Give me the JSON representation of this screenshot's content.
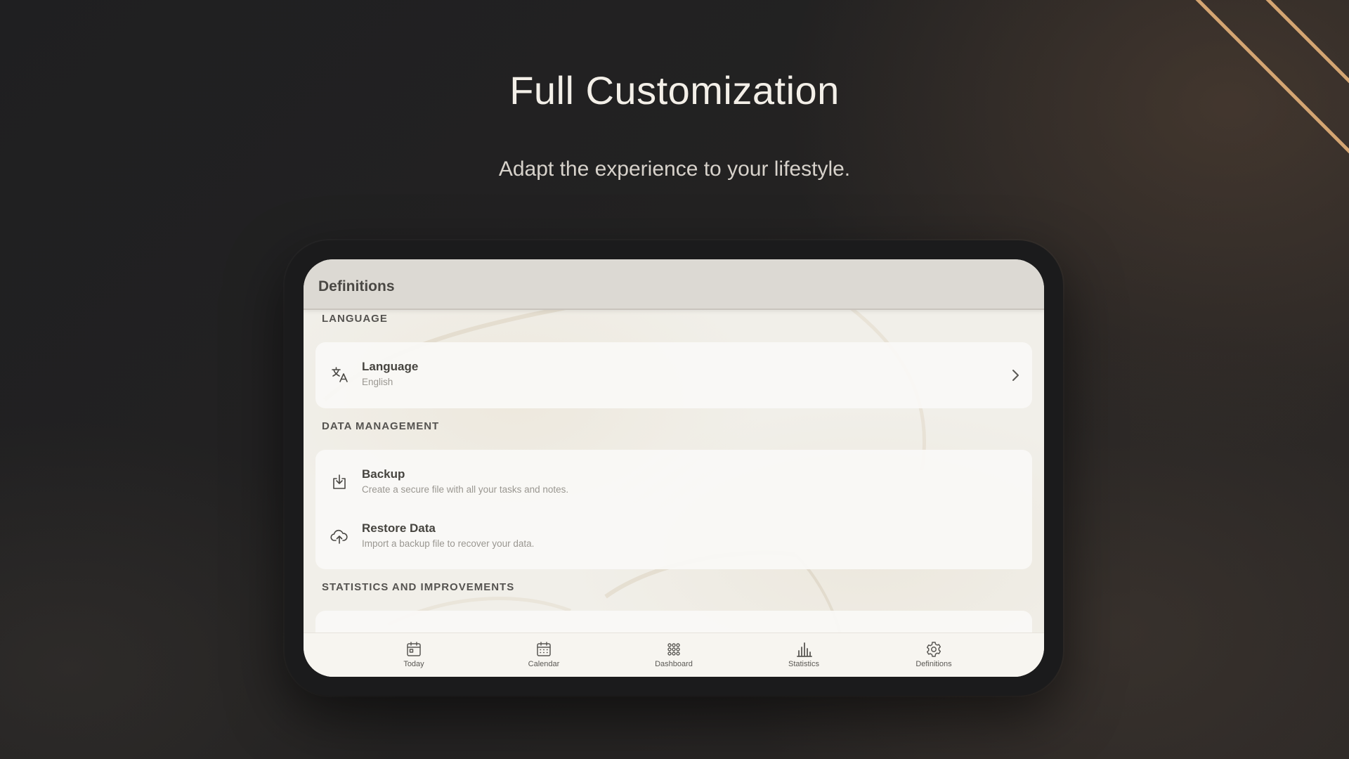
{
  "hero": {
    "title": "Full Customization",
    "subtitle": "Adapt the experience to your lifestyle."
  },
  "colors": {
    "accent_lines": "#d4a572",
    "background": "#232222",
    "screen_background": "#f1efe9"
  },
  "app": {
    "header_title": "Definitions",
    "sections": [
      {
        "label": "LANGUAGE",
        "items": [
          {
            "icon": "translate-icon",
            "title": "Language",
            "description": "English",
            "has_chevron": true
          }
        ]
      },
      {
        "label": "DATA MANAGEMENT",
        "items": [
          {
            "icon": "download-icon",
            "title": "Backup",
            "description": "Create a secure file with all your tasks and notes."
          },
          {
            "icon": "cloud-upload-icon",
            "title": "Restore Data",
            "description": "Import a backup file to recover your data."
          }
        ]
      },
      {
        "label": "STATISTICS AND IMPROVEMENTS",
        "items": []
      }
    ],
    "nav": [
      {
        "icon": "calendar-day-icon",
        "label": "Today"
      },
      {
        "icon": "calendar-icon",
        "label": "Calendar"
      },
      {
        "icon": "grid-dots-icon",
        "label": "Dashboard"
      },
      {
        "icon": "bar-chart-icon",
        "label": "Statistics"
      },
      {
        "icon": "gear-icon",
        "label": "Definitions"
      }
    ]
  }
}
